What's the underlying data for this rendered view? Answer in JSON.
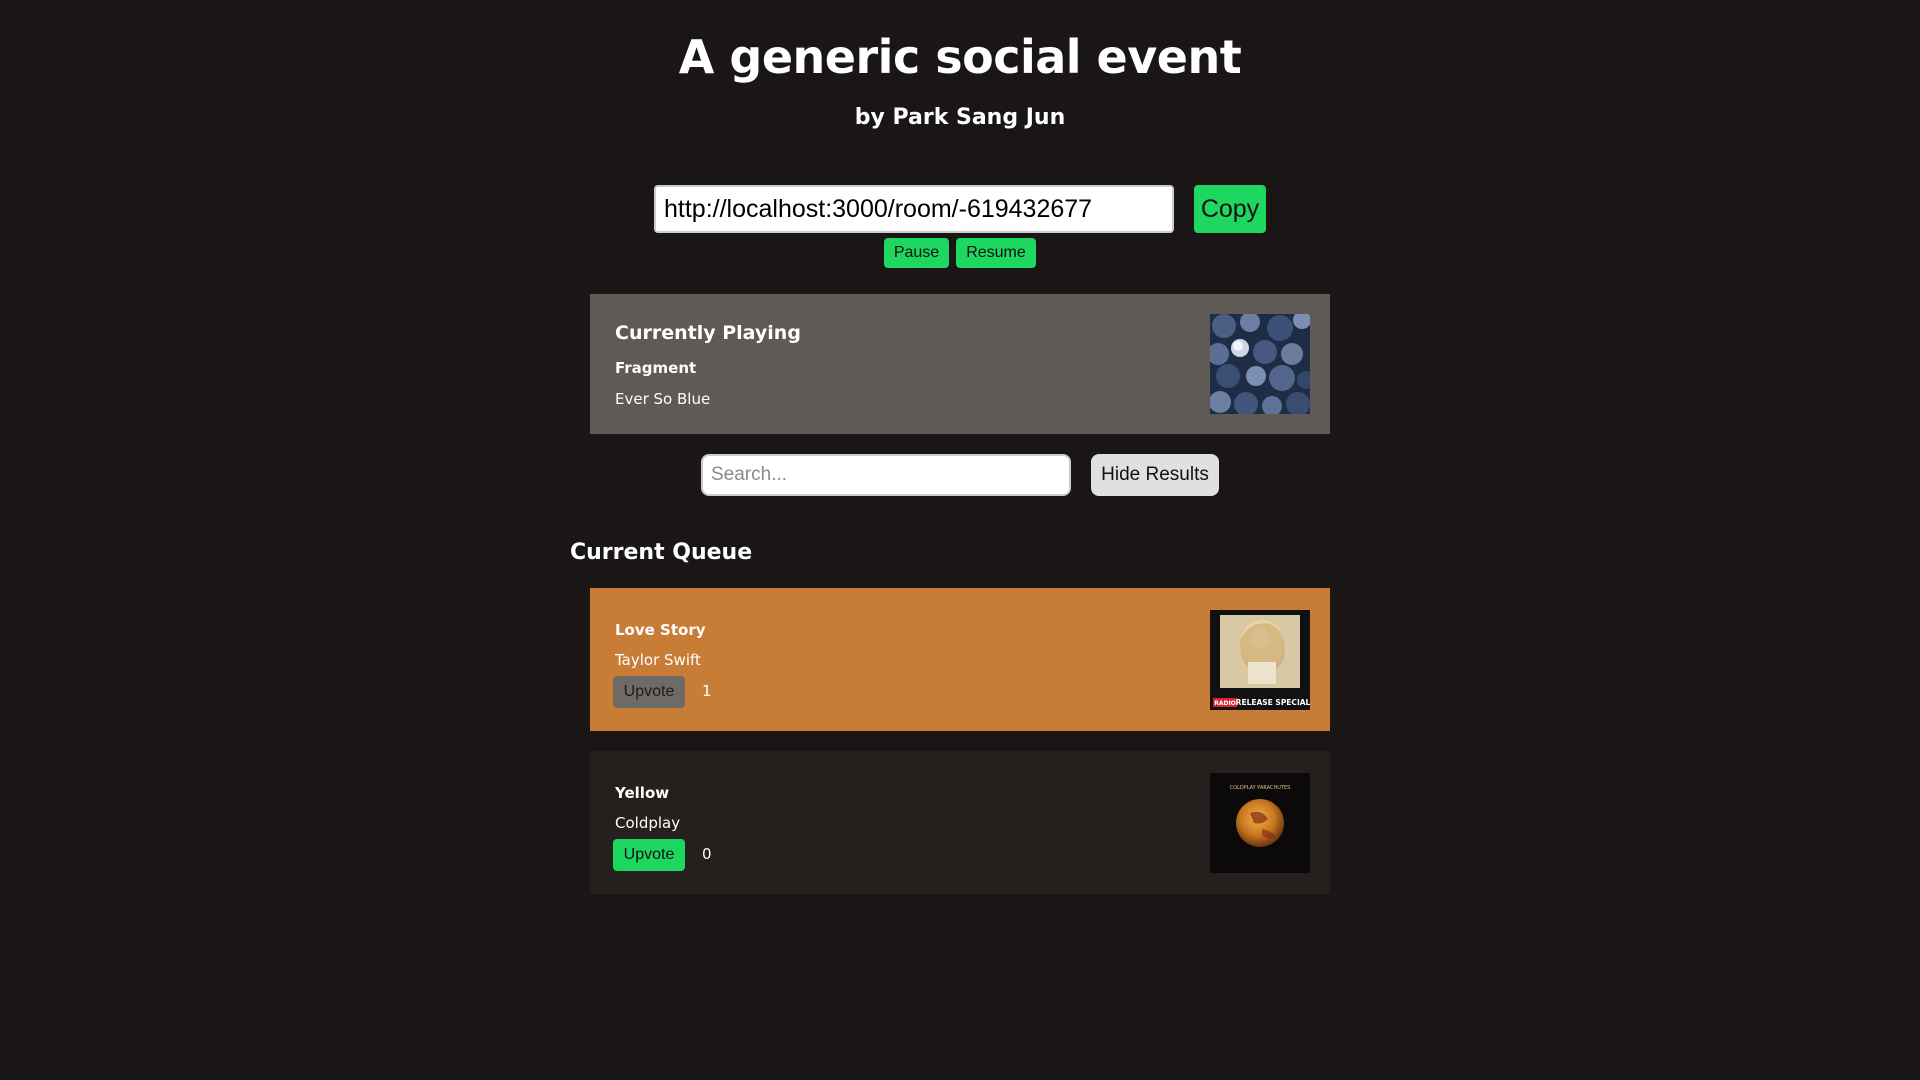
{
  "event": {
    "title": "A generic social event",
    "host": "by Park Sang Jun"
  },
  "share": {
    "url": "http://localhost:3000/room/-619432677",
    "copy_label": "Copy"
  },
  "playback": {
    "pause_label": "Pause",
    "resume_label": "Resume"
  },
  "now_playing": {
    "heading": "Currently Playing",
    "track": "Fragment",
    "artist": "Ever So Blue"
  },
  "search": {
    "placeholder": "Search...",
    "value": "",
    "hide_label": "Hide Results"
  },
  "queue": {
    "heading": "Current Queue",
    "items": [
      {
        "title": "Love Story",
        "artist": "Taylor Swift",
        "upvote_label": "Upvote",
        "votes": "1",
        "background": "#c87d37",
        "upvote_color": "#6e6a66",
        "upvoted": true,
        "art_caption": "RADIO RELEASE SPECIAL"
      },
      {
        "title": "Yellow",
        "artist": "Coldplay",
        "upvote_label": "Upvote",
        "votes": "0",
        "background": "#24201d",
        "upvote_color": "#1ed760",
        "upvoted": false,
        "art_caption": "COLDPLAY PARACHUTES"
      }
    ]
  },
  "colors": {
    "background": "#1a1615",
    "accent": "#1ed760",
    "now_playing_panel": "#5e5a55"
  }
}
